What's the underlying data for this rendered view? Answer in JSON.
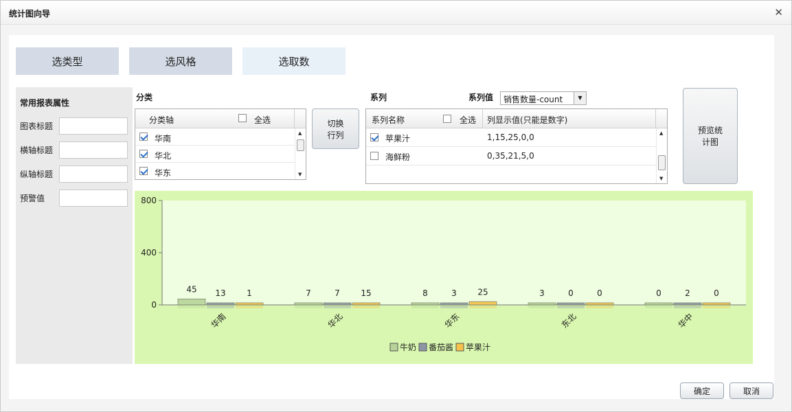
{
  "dialog": {
    "title": "统计图向导"
  },
  "steps": [
    {
      "label": "选类型"
    },
    {
      "label": "选风格"
    },
    {
      "label": "选取数"
    }
  ],
  "properties": {
    "header": "常用报表属性",
    "chart_title": {
      "label": "图表标题",
      "value": ""
    },
    "x_axis_title": {
      "label": "横轴标题",
      "value": ""
    },
    "y_axis_title": {
      "label": "纵轴标题",
      "value": ""
    },
    "warning_value": {
      "label": "预警值",
      "value": ""
    }
  },
  "category": {
    "label": "分类",
    "column_header": "分类轴",
    "select_all_label": "全选",
    "items": [
      {
        "name": "华南",
        "checked": true
      },
      {
        "name": "华北",
        "checked": true
      },
      {
        "name": "华东",
        "checked": true
      }
    ]
  },
  "swap_button": {
    "line1": "切换",
    "line2": "行列"
  },
  "series": {
    "label": "系列",
    "value_label": "系列值",
    "value_select": "销售数量-count",
    "name_header": "系列名称",
    "select_all_label": "全选",
    "values_header": "列显示值(只能是数字)",
    "items": [
      {
        "name": "苹果汁",
        "values": "1,15,25,0,0",
        "checked": true
      },
      {
        "name": "海鲜粉",
        "values": "0,35,21,5,0",
        "checked": false
      }
    ]
  },
  "preview_button": {
    "line1": "预览统",
    "line2": "计图"
  },
  "buttons": {
    "ok": "确定",
    "cancel": "取消"
  },
  "chart_data": {
    "type": "bar",
    "categories": [
      "华南",
      "华北",
      "华东",
      "东北",
      "华中"
    ],
    "series": [
      {
        "name": "牛奶",
        "values": [
          45,
          7,
          8,
          3,
          0
        ],
        "color": "#b7d39a"
      },
      {
        "name": "番茄酱",
        "values": [
          13,
          7,
          3,
          0,
          2
        ],
        "color": "#8e96a6"
      },
      {
        "name": "苹果汁",
        "values": [
          1,
          15,
          25,
          0,
          0
        ],
        "color": "#f6c24a"
      }
    ],
    "ylim": [
      0,
      800
    ],
    "yticks": [
      0,
      400,
      800
    ],
    "legend": "bottom-center",
    "grid": false
  }
}
